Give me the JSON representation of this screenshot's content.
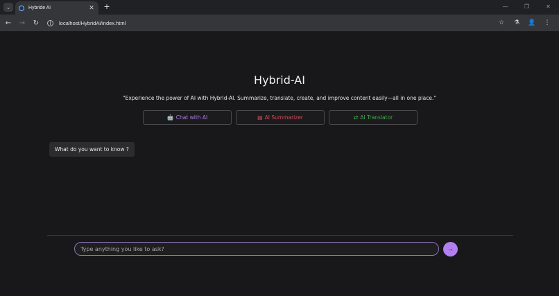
{
  "browser": {
    "tab_list_icon": "chevron-down-icon",
    "tab_title": "Hybride Ai",
    "tab_close": "✕",
    "new_tab": "+",
    "window_controls": [
      "—",
      "❐",
      "✕"
    ],
    "url": "localhost/HybridAi/index.html",
    "nav": {
      "back": "←",
      "forward": "→",
      "reload": "↻"
    },
    "right_icons": {
      "bookmark": "☆",
      "labs": "⚗",
      "profile": "👤",
      "menu": "⋮"
    }
  },
  "page": {
    "title": "Hybrid-AI",
    "subtitle": "\"Experience the power of AI with Hybrid-AI. Summarize, translate, create, and improve content easily—all in one place.\"",
    "modes": {
      "chat": {
        "icon": "🤖",
        "label": "Chat with AI",
        "color": "#b07cf0"
      },
      "summarizer": {
        "icon": "▤",
        "label": "AI Summarizer",
        "color": "#e0445a"
      },
      "translator": {
        "icon": "⇄",
        "label": "AI Translator",
        "color": "#3fae4a"
      }
    },
    "bot_message": "What do you want to know ?",
    "input_placeholder": "Type anything you like to ask?",
    "send_icon": "→"
  }
}
